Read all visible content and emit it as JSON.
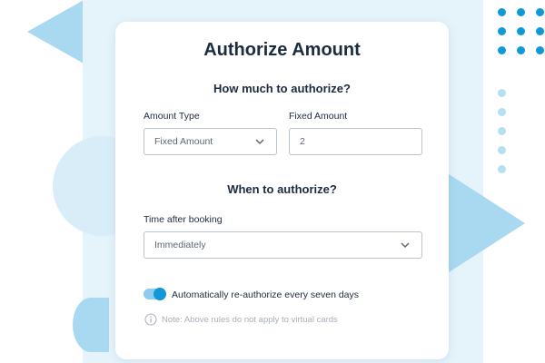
{
  "card": {
    "title": "Authorize Amount",
    "section_amount_heading": "How much to authorize?",
    "amount_type": {
      "label": "Amount Type",
      "selected": "Fixed Amount"
    },
    "fixed_amount": {
      "label": "Fixed Amount",
      "value": "2"
    },
    "section_time_heading": "When to authorize?",
    "time_after_booking": {
      "label": "Time after booking",
      "selected": "Immediately"
    },
    "reauthorize_toggle": {
      "label": "Automatically re-authorize every seven days",
      "on": true
    },
    "note": "Note: Above rules do not apply to virtual cards"
  },
  "icons": {
    "dropdown": "chevron-down-icon",
    "info": "info-icon"
  },
  "colors": {
    "accent": "#1297d8",
    "toggle_track": "#8ecbee",
    "panel_bg": "#e5f3fb",
    "decor_shape": "#a9d8f1",
    "text_dark": "#1d2b3f",
    "note_text": "#a7b0b9"
  }
}
